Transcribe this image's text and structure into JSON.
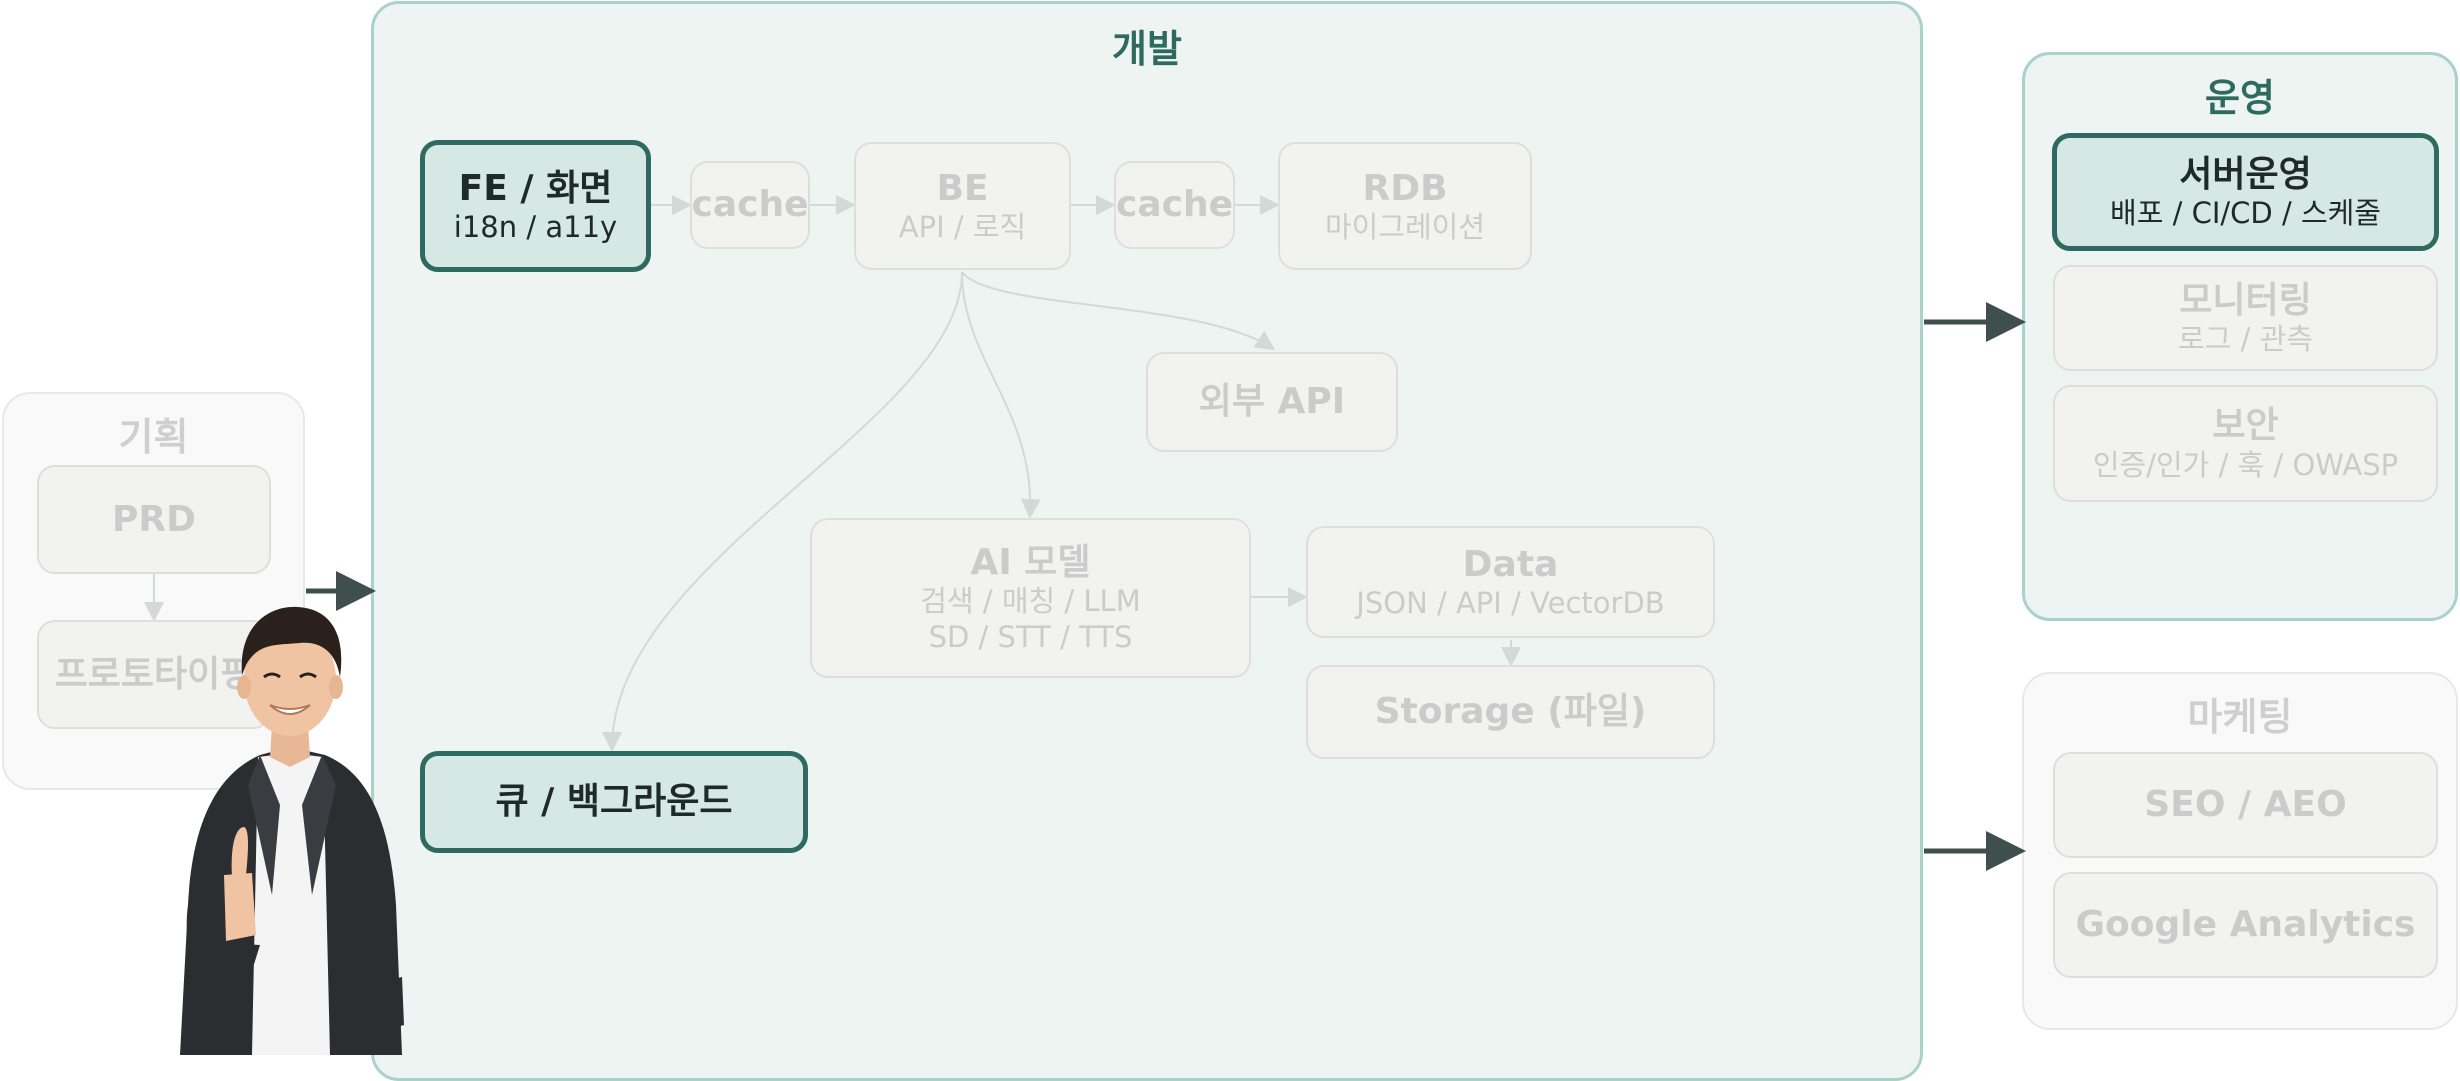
{
  "colors": {
    "accent": "#2e6a60",
    "group_title_active": "#2e6a60",
    "group_bg": "#edf4f2",
    "active_node_bg": "#d5e8e4",
    "dim_text": "#cbcbcb"
  },
  "groups": {
    "planning": {
      "title": "기획"
    },
    "dev": {
      "title": "개발"
    },
    "ops": {
      "title": "운영"
    },
    "marketing": {
      "title": "마케팅"
    }
  },
  "nodes": {
    "prd": {
      "title": "PRD"
    },
    "prototype": {
      "title": "프로토타이핑"
    },
    "fe": {
      "title": "FE / 화면",
      "sub": "i18n / a11y"
    },
    "cache1": {
      "title": "cache"
    },
    "be": {
      "title": "BE",
      "sub": "API / 로직"
    },
    "cache2": {
      "title": "cache"
    },
    "rdb": {
      "title": "RDB",
      "sub": "마이그레이션"
    },
    "external_api": {
      "title": "외부 API"
    },
    "ai_model": {
      "title": "AI 모델",
      "sub": "검색 / 매칭 / LLM",
      "sub2": "SD / STT / TTS"
    },
    "data": {
      "title": "Data",
      "sub": "JSON / API / VectorDB"
    },
    "storage": {
      "title": "Storage (파일)"
    },
    "queue": {
      "title": "큐 / 백그라운드"
    },
    "server_ops": {
      "title": "서버운영",
      "sub": "배포 / CI/CD / 스케줄"
    },
    "monitoring": {
      "title": "모니터링",
      "sub": "로그 / 관측"
    },
    "security": {
      "title": "보안",
      "sub": "인증/인가 / 훅 / OWASP"
    },
    "seo": {
      "title": "SEO / AEO"
    },
    "analytics": {
      "title": "Google Analytics"
    }
  },
  "illustration": {
    "name": "smiling man in suit giving thumbs up"
  }
}
